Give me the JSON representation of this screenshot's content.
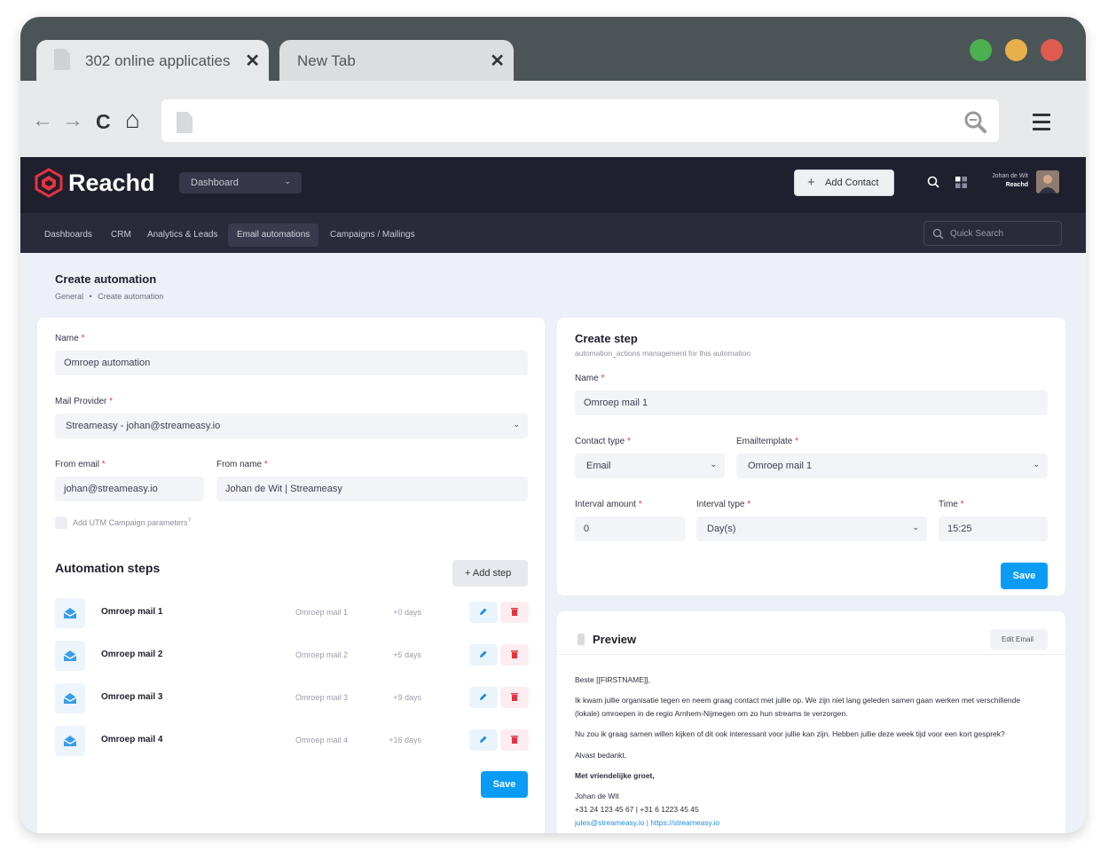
{
  "browser": {
    "tabs": [
      {
        "title": "302 online applicaties",
        "close": "✕"
      },
      {
        "title": "New Tab",
        "close": "✕"
      }
    ],
    "window_dots": [
      "#4caf50",
      "#e8b04a",
      "#e05a50"
    ],
    "nav": {
      "back": "←",
      "forward": "→",
      "reload": "C",
      "home": "⌂"
    },
    "url": ""
  },
  "app": {
    "brand": "Reachd",
    "brand_color": "#e5333f",
    "dashboard_select": "Dashboard",
    "add_contact": "Add Contact",
    "user": {
      "name": "Johan de Wit",
      "company": "Reachd"
    },
    "menu": [
      "Dashboards",
      "CRM",
      "Analytics & Leads",
      "Email automations",
      "Campaigns / Mailings"
    ],
    "active_menu": "Email automations",
    "quick_search": "Quick Search"
  },
  "page": {
    "title": "Create automation",
    "breadcrumb": [
      "General",
      "Create automation"
    ],
    "breadcrumb_sep": "•"
  },
  "form": {
    "name_label": "Name",
    "name_value": "Omroep automation",
    "provider_label": "Mail Provider",
    "provider_value": "Streameasy - johan@streameasy.io",
    "from_email_label": "From email",
    "from_email_value": "johan@streameasy.io",
    "from_name_label": "From name",
    "from_name_value": "Johan de Wit | Streameasy",
    "utm_label": "Add UTM Campaign parameters",
    "utm_help": "?",
    "required": "*"
  },
  "steps": {
    "title": "Automation steps",
    "add_label": "+ Add step",
    "save_label": "Save",
    "items": [
      {
        "name": "Omroep mail 1",
        "template": "Omroep mail 1",
        "delay": "+0 days"
      },
      {
        "name": "Omroep mail 2",
        "template": "Omroep mail 2",
        "delay": "+5 days"
      },
      {
        "name": "Omroep mail 3",
        "template": "Omroep mail 3",
        "delay": "+9 days"
      },
      {
        "name": "Omroep mail 4",
        "template": "Omroep mail 4",
        "delay": "+16 days"
      }
    ]
  },
  "create_step": {
    "title": "Create step",
    "subtitle": "automation_actions management for this automation",
    "name_label": "Name",
    "name_value": "Omroep mail 1",
    "contact_type_label": "Contact type",
    "contact_type_value": "Email",
    "template_label": "Emailtemplate",
    "template_value": "Omroep mail 1",
    "interval_amount_label": "Interval amount",
    "interval_amount_value": "0",
    "interval_type_label": "Interval type",
    "interval_type_value": "Day(s)",
    "time_label": "Time",
    "time_value": "15:25",
    "save_label": "Save"
  },
  "preview": {
    "title": "Preview",
    "edit_label": "Edit Email",
    "lines": [
      "Beste [[FIRSTNAME]],",
      "Ik kwam jullie organisatie tegen en neem graag contact met jullie op. We zijn niet lang geleden samen gaan werken met verschillende (lokale) omroepen in de regio Arnhem-Nijmegen om zo hun streams te verzorgen.",
      "Nu zou ik graag samen willen kijken of dit ook interessant voor jullie kan zijn. Hebben jullie deze week tijd voor een kort gesprek?",
      "Alvast bedankt,",
      "Met vriendelijke groet,",
      "Johan de Wit",
      "+31 24 123 45 67 | +31 6 1223 45 45",
      "jules@streameasy.io | https://streameasy.io"
    ]
  }
}
